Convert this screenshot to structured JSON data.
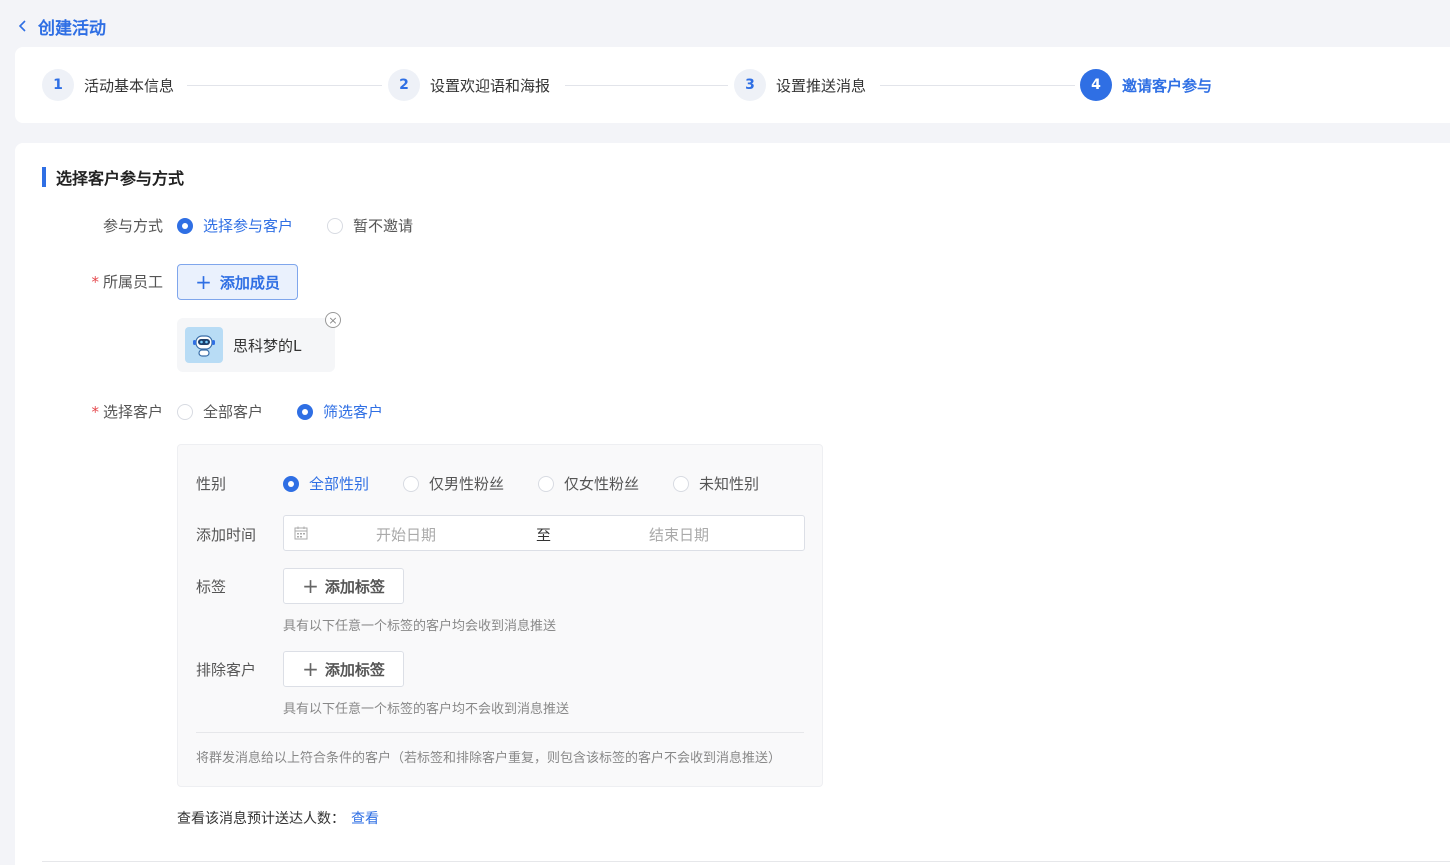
{
  "header": {
    "back_label": "创建活动"
  },
  "steps": [
    {
      "num": "1",
      "label": "活动基本信息"
    },
    {
      "num": "2",
      "label": "设置欢迎语和海报"
    },
    {
      "num": "3",
      "label": "设置推送消息"
    },
    {
      "num": "4",
      "label": "邀请客户参与"
    }
  ],
  "section": {
    "title": "选择客户参与方式"
  },
  "form": {
    "participation": {
      "label": "参与方式",
      "options": [
        "选择参与客户",
        "暂不邀请"
      ],
      "selected": "选择参与客户"
    },
    "staff": {
      "label": "所属员工",
      "add_button": "添加成员",
      "members": [
        {
          "name": "思科梦的L"
        }
      ]
    },
    "customers": {
      "label": "选择客户",
      "options": [
        "全部客户",
        "筛选客户"
      ],
      "selected": "筛选客户"
    }
  },
  "filter": {
    "gender": {
      "label": "性别",
      "options": [
        "全部性别",
        "仅男性粉丝",
        "仅女性粉丝",
        "未知性别"
      ],
      "selected": "全部性别"
    },
    "add_time": {
      "label": "添加时间",
      "start_placeholder": "开始日期",
      "separator": "至",
      "end_placeholder": "结束日期"
    },
    "tags": {
      "label": "标签",
      "button": "添加标签",
      "hint": "具有以下任意一个标签的客户均会收到消息推送"
    },
    "exclude": {
      "label": "排除客户",
      "button": "添加标签",
      "hint": "具有以下任意一个标签的客户均不会收到消息推送"
    },
    "footnote": "将群发消息给以上符合条件的客户（若标签和排除客户重复，则包含该标签的客户不会收到消息推送）"
  },
  "preview": {
    "text": "查看该消息预计送达人数：",
    "link": "查看"
  },
  "colors": {
    "accent": "#2f6fe4",
    "required": "#e5484d"
  }
}
